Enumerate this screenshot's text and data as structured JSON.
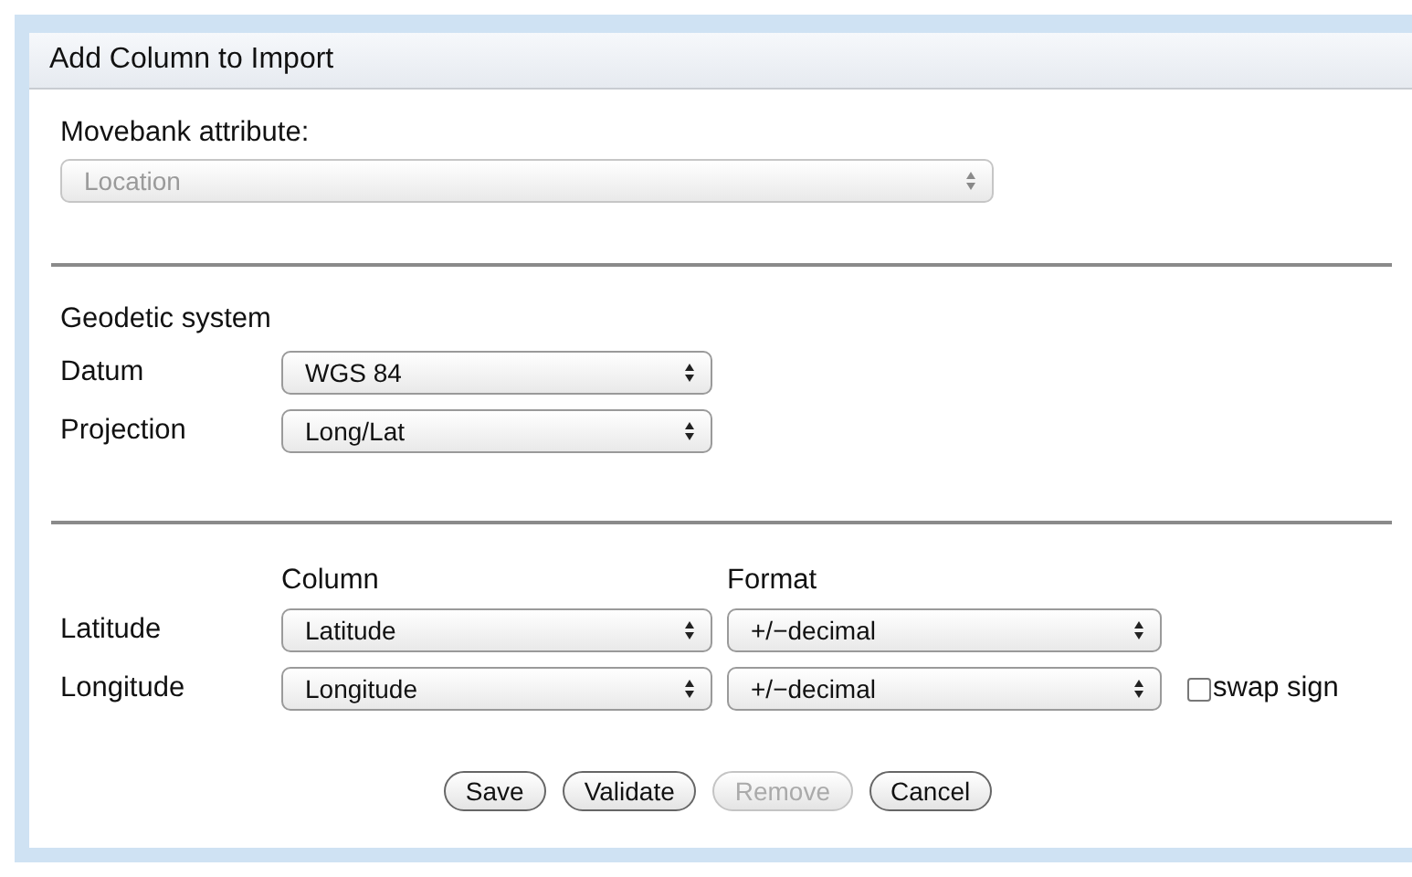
{
  "window": {
    "title": "Add Column to Import"
  },
  "attribute": {
    "label": "Movebank attribute:",
    "value": "Location",
    "disabled": true
  },
  "geodetic": {
    "heading": "Geodetic system",
    "fields": [
      {
        "label": "Datum",
        "value": "WGS 84"
      },
      {
        "label": "Projection",
        "value": "Long/Lat"
      }
    ]
  },
  "columns": {
    "headers": [
      "Column",
      "Format"
    ],
    "rows": [
      {
        "label": "Latitude",
        "column": "Latitude",
        "format": "+/−decimal"
      },
      {
        "label": "Longitude",
        "column": "Longitude",
        "format": "+/−decimal",
        "swap": {
          "label": "swap sign",
          "checked": false
        }
      }
    ]
  },
  "buttons": [
    {
      "label": "Save",
      "disabled": false
    },
    {
      "label": "Validate",
      "disabled": false
    },
    {
      "label": "Remove",
      "disabled": true
    },
    {
      "label": "Cancel",
      "disabled": false
    }
  ]
}
